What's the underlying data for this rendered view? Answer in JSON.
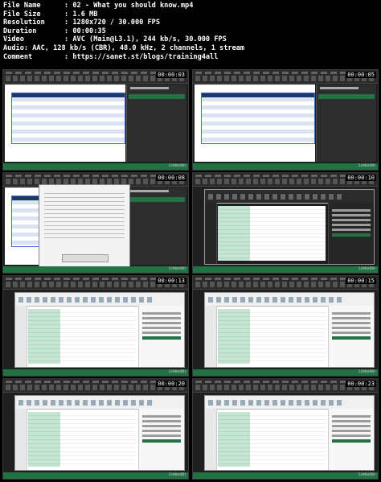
{
  "info": [
    {
      "key": "File Name",
      "value": ":  02 - What you should know.mp4"
    },
    {
      "key": "File Size",
      "value": ":  1.6 MB"
    },
    {
      "key": "Resolution",
      "value": ":  1280x720 / 30.000 FPS"
    },
    {
      "key": "Duration",
      "value": ":  00:00:35"
    },
    {
      "key": "Video",
      "value": ":  AVC (Main@L3.1), 244 kb/s, 30.000 FPS"
    },
    {
      "key": "Audio",
      "value": ":  AAC, 128 kb/s (CBR), 48.0 kHz, 2 channels, 1 stream"
    },
    {
      "key": "Comment",
      "value": ":  https://sanet.st/blogs/training4all"
    }
  ],
  "thumbnails": [
    {
      "timestamp": "00:00:03",
      "kind": "excel",
      "brand": "LinkedIn"
    },
    {
      "timestamp": "00:00:05",
      "kind": "excel",
      "brand": "LinkedIn"
    },
    {
      "timestamp": "00:00:08",
      "kind": "dialog",
      "brand": "LinkedIn"
    },
    {
      "timestamp": "00:00:10",
      "kind": "pq-dark",
      "brand": "LinkedIn"
    },
    {
      "timestamp": "00:00:13",
      "kind": "pq",
      "brand": "LinkedIn"
    },
    {
      "timestamp": "00:00:15",
      "kind": "pq",
      "brand": "LinkedIn"
    },
    {
      "timestamp": "00:00:20",
      "kind": "pq",
      "brand": "LinkedIn"
    },
    {
      "timestamp": "00:00:23",
      "kind": "pq",
      "brand": "LinkedIn"
    }
  ]
}
